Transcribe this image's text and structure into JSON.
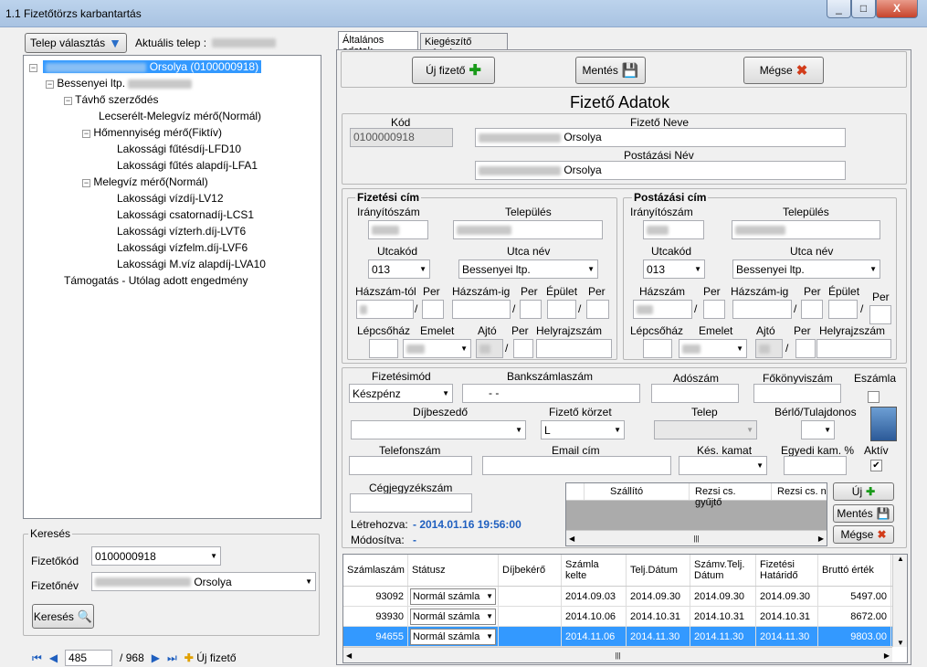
{
  "window": {
    "title": "1.1 Fizetőtörzs karbantartás",
    "min": "_",
    "max": "□",
    "close": "X"
  },
  "left": {
    "telep_btn": "Telep választás",
    "aktualis_label": "Aktuális telep :",
    "tree": {
      "root": "Orsolya (0100000918)",
      "n1": "Bessenyei ltp.",
      "n2": "Távhő szerződés",
      "n3": "Lecserélt-Melegvíz mérő(Normál)",
      "n4": "Hőmennyiség mérő(Fiktív)",
      "n5": "Lakossági fűtésdíj-LFD10",
      "n6": "Lakossági fűtés alapdíj-LFA1",
      "n7": "Melegvíz mérő(Normál)",
      "n8": "Lakossági vízdíj-LV12",
      "n9": "Lakossági csatornadíj-LCS1",
      "n10": "Lakossági vízterh.díj-LVT6",
      "n11": "Lakossági vízfelm.díj-LVF6",
      "n12": "Lakossági M.víz alapdíj-LVA10",
      "n13": "Támogatás - Utólag adott engedmény"
    },
    "kereses": {
      "title": "Keresés",
      "kod_label": "Fizetőkód",
      "kod_value": "0100000918",
      "nev_label": "Fizetőnév",
      "nev_value": "Orsolya",
      "btn": "Keresés"
    },
    "nav": {
      "pos": "485",
      "total": "/ 968",
      "uj": "Új fizető"
    }
  },
  "tabs": {
    "t1": "Általános adatok",
    "t2": "Kiegészítő adatok"
  },
  "toolbar": {
    "uj": "Új fizető",
    "mentes": "Mentés",
    "megse": "Mégse"
  },
  "form": {
    "title": "Fizető Adatok",
    "kod_label": "Kód",
    "kod_value": "0100000918",
    "nev_label": "Fizető Neve",
    "nev_value": "Orsolya",
    "post_nev_label": "Postázási Név",
    "post_nev_value": "Orsolya",
    "fiz_cim": "Fizetési cím",
    "post_cim": "Postázási cím",
    "iranyito": "Irányítószám",
    "telepules": "Település",
    "utcakod": "Utcakód",
    "utcanev": "Utca név",
    "utcakod_val": "013",
    "utcanev_val": "Bessenyei ltp.",
    "hazszam_tol": "Házszám-tól",
    "hazszam": "Házszám",
    "per": "Per",
    "hazszam_ig": "Házszám-ig",
    "epulet": "Épület",
    "lepcsohaz": "Lépcsőház",
    "emelet": "Emelet",
    "ajto": "Ajtó",
    "helyrajz": "Helyrajzszám",
    "slash": "/",
    "fizmod_label": "Fizetésimód",
    "fizmod_val": "Készpénz",
    "bank_label": "Bankszámlaszám",
    "bank_val": "-         -",
    "adoszam": "Adószám",
    "fokonyv": "Főkönyviszám",
    "eszamla": "Eszámla",
    "dijbeszedo": "Díjbeszedő",
    "korzet_label": "Fizető körzet",
    "korzet_val": "L",
    "telep": "Telep",
    "berlo": "Bérlő/Tulajdonos",
    "telefon": "Telefonszám",
    "email": "Email cím",
    "kes_kamat": "Kés. kamat",
    "egyedi_kam": "Egyedi kam. %",
    "aktiv": "Aktív",
    "cegjegyzek": "Cégjegyzékszám",
    "letrehozva_label": "Létrehozva:",
    "letrehozva_val": "- 2014.01.16 19:56:00",
    "modositva_label": "Módosítva:",
    "modositva_val": "-"
  },
  "subgrid": {
    "cols": [
      "Szállító",
      "Rezsi cs. gyűjtő",
      "Rezsi cs. n"
    ],
    "uj": "Új",
    "mentes": "Mentés",
    "megse": "Mégse"
  },
  "grid": {
    "headers": [
      "Számlaszám",
      "Státusz",
      "Díjbekérő",
      "Számla kelte",
      "Telj.Dátum",
      "Számv.Telj. Dátum",
      "Fizetési Határidő",
      "Bruttó érték"
    ],
    "rows": [
      [
        "93092",
        "Normál számla",
        "",
        "2014.09.03",
        "2014.09.30",
        "2014.09.30",
        "2014.09.30",
        "5497.00"
      ],
      [
        "93930",
        "Normál számla",
        "",
        "2014.10.06",
        "2014.10.31",
        "2014.10.31",
        "2014.10.31",
        "8672.00"
      ],
      [
        "94655",
        "Normál számla",
        "",
        "2014.11.06",
        "2014.11.30",
        "2014.11.30",
        "2014.11.30",
        "9803.00"
      ]
    ]
  }
}
